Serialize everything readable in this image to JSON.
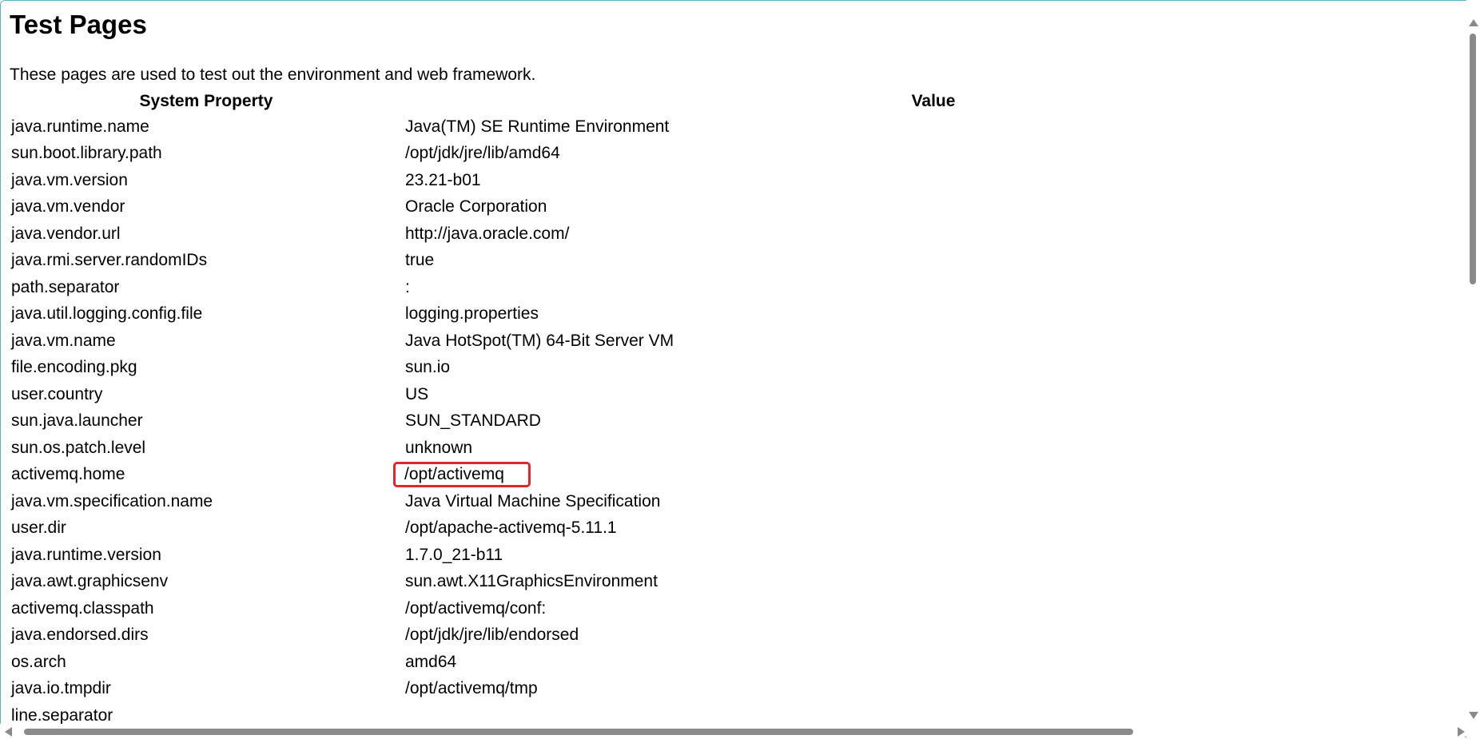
{
  "page": {
    "title": "Test Pages",
    "description": "These pages are used to test out the environment and web framework."
  },
  "table": {
    "headers": [
      "System Property",
      "Value"
    ],
    "rows": [
      {
        "property": "java.runtime.name",
        "value": "Java(TM) SE Runtime Environment"
      },
      {
        "property": "sun.boot.library.path",
        "value": "/opt/jdk/jre/lib/amd64"
      },
      {
        "property": "java.vm.version",
        "value": "23.21-b01"
      },
      {
        "property": "java.vm.vendor",
        "value": "Oracle Corporation"
      },
      {
        "property": "java.vendor.url",
        "value": "http://java.oracle.com/"
      },
      {
        "property": "java.rmi.server.randomIDs",
        "value": "true"
      },
      {
        "property": "path.separator",
        "value": ":"
      },
      {
        "property": "java.util.logging.config.file",
        "value": "logging.properties"
      },
      {
        "property": "java.vm.name",
        "value": "Java HotSpot(TM) 64-Bit Server VM"
      },
      {
        "property": "file.encoding.pkg",
        "value": "sun.io"
      },
      {
        "property": "user.country",
        "value": "US"
      },
      {
        "property": "sun.java.launcher",
        "value": "SUN_STANDARD"
      },
      {
        "property": "sun.os.patch.level",
        "value": "unknown"
      },
      {
        "property": "activemq.home",
        "value": "/opt/activemq",
        "highlighted": true
      },
      {
        "property": "java.vm.specification.name",
        "value": "Java Virtual Machine Specification"
      },
      {
        "property": "user.dir",
        "value": "/opt/apache-activemq-5.11.1"
      },
      {
        "property": "java.runtime.version",
        "value": "1.7.0_21-b11"
      },
      {
        "property": "java.awt.graphicsenv",
        "value": "sun.awt.X11GraphicsEnvironment"
      },
      {
        "property": "activemq.classpath",
        "value": "/opt/activemq/conf:"
      },
      {
        "property": "java.endorsed.dirs",
        "value": "/opt/jdk/jre/lib/endorsed"
      },
      {
        "property": "os.arch",
        "value": "amd64"
      },
      {
        "property": "java.io.tmpdir",
        "value": "/opt/activemq/tmp"
      },
      {
        "property": "line.separator",
        "value": ""
      }
    ]
  },
  "colors": {
    "highlight_border": "#e3262b",
    "window_border": "#5fb6c2",
    "scrollbar": "#8a8a8a"
  }
}
